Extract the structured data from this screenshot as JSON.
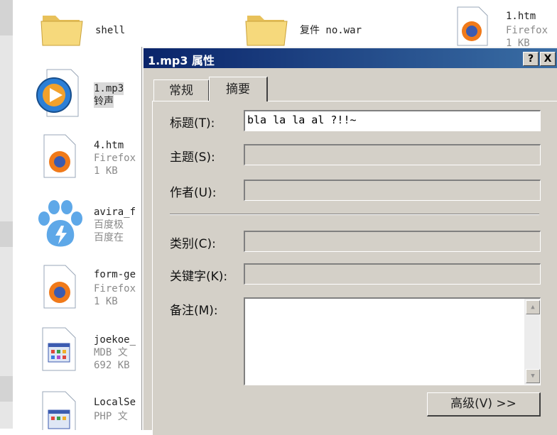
{
  "files": [
    {
      "name": "shell",
      "sub": "",
      "sub2": "",
      "icon": "folder-icon"
    },
    {
      "name": "复件 no.war",
      "sub": "",
      "sub2": "",
      "icon": "folder-icon"
    },
    {
      "name": "1.htm",
      "sub": "Firefox",
      "sub2": "1 KB",
      "icon": "firefox-icon"
    },
    {
      "name": "1.mp3",
      "sub": "铃声",
      "sub2": "",
      "icon": "media-player-icon"
    },
    {
      "name": "4.htm",
      "sub": "Firefox",
      "sub2": "1 KB",
      "icon": "firefox-icon"
    },
    {
      "name": "avira_f",
      "sub": "百度极",
      "sub2": "百度在",
      "icon": "baidu-icon"
    },
    {
      "name": "form-ge",
      "sub": "Firefox",
      "sub2": "1 KB",
      "icon": "firefox-icon"
    },
    {
      "name": "joekoe_",
      "sub": "MDB 文",
      "sub2": "692 KB",
      "icon": "app-window-icon"
    },
    {
      "name": "LocalSe",
      "sub": "PHP 文",
      "sub2": "",
      "icon": "app-window-icon"
    }
  ],
  "dialog": {
    "title": "1.mp3 属性",
    "help_btn": "?",
    "close_btn": "X",
    "tabs": [
      {
        "label": "常规"
      },
      {
        "label": "摘要"
      }
    ],
    "fields": {
      "title_label": "标题(T):",
      "title_value": "bla la la al ?!!~",
      "subject_label": "主题(S):",
      "author_label": "作者(U):",
      "category_label": "类别(C):",
      "keywords_label": "关键字(K):",
      "comments_label": "备注(M):"
    },
    "advanced_btn": "高级(V) >>"
  }
}
